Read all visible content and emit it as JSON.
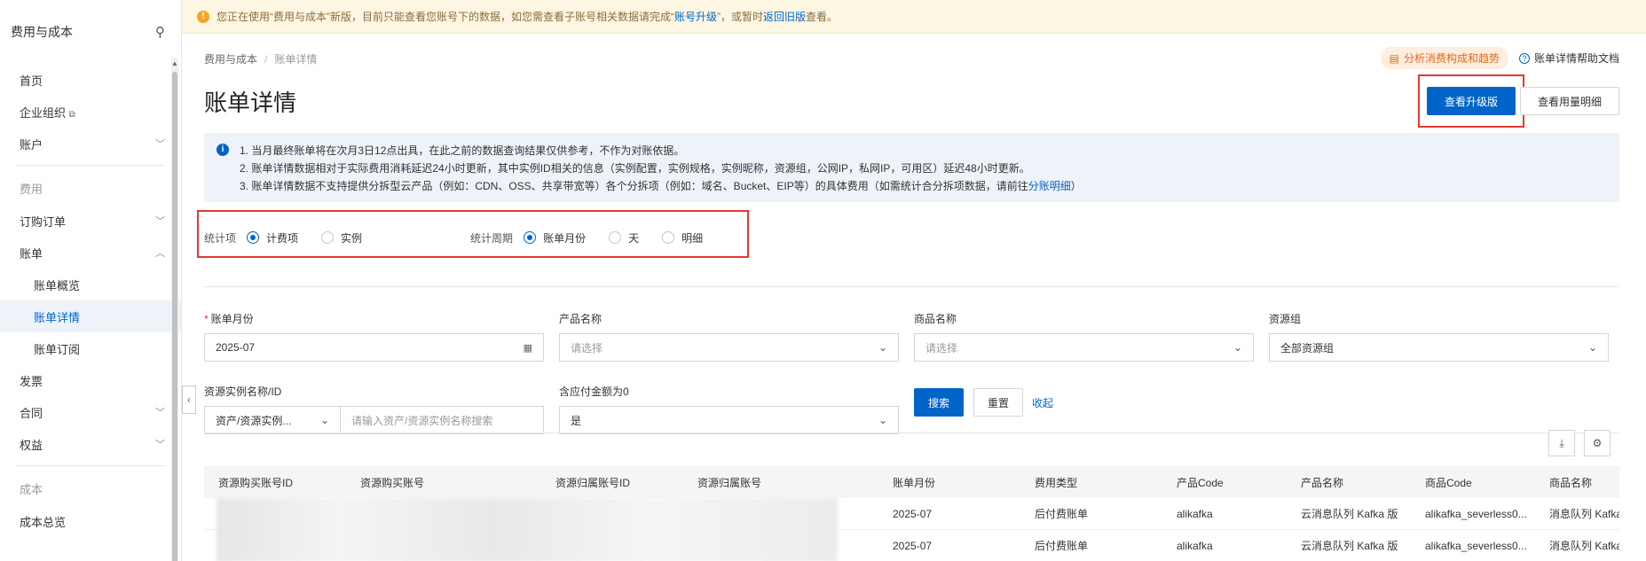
{
  "banner": {
    "text_before": "您正在使用“费用与成本”新版，目前只能查看您账号下的数据，如您需查看子账号相关数据请完成“",
    "link_upgrade": "账号升级",
    "text_middle": "”，或暂时",
    "link_old": "返回旧版",
    "text_after": "查看。"
  },
  "sidebar": {
    "title": "费用与成本",
    "items": [
      {
        "label": "首页"
      },
      {
        "label": "企业组织",
        "ext": "⧉"
      },
      {
        "label": "账户",
        "chev": "﹀"
      }
    ],
    "group_fee": "费用",
    "fee_items": [
      {
        "label": "订购订单",
        "chev": "﹀"
      },
      {
        "label": "账单",
        "chev": "︿"
      }
    ],
    "bill_sub": [
      "账单概览",
      "账单详情",
      "账单订阅"
    ],
    "fee_items2": [
      {
        "label": "发票"
      },
      {
        "label": "合同",
        "chev": "﹀"
      },
      {
        "label": "权益",
        "chev": "﹀"
      }
    ],
    "group_cost": "成本",
    "cost_items": [
      "成本总览"
    ]
  },
  "breadcrumb": {
    "root": "费用与成本",
    "sep": "/",
    "current": "账单详情"
  },
  "page": {
    "title": "账单详情",
    "analyze": "分析消费构成和趋势",
    "help": "账单详情帮助文档",
    "btn_upgrade": "查看升级版",
    "btn_usage": "查看用量明细"
  },
  "notice": {
    "line1": "1. 当月最终账单将在次月3日12点出具，在此之前的数据查询结果仅供参考，不作为对账依据。",
    "line2": "2. 账单详情数据相对于实际费用消耗延迟24小时更新，其中实例ID相关的信息（实例配置，实例规格，实例昵称，资源组，公网IP，私网IP，可用区）延迟48小时更新。",
    "line3_before": "3. 账单详情数据不支持提供分拆型云产品（例如：CDN、OSS、共享带宽等）各个分拆项（例如：域名、Bucket、EIP等）的具体费用（如需统计合分拆项数据，请前往",
    "line3_link": "分账明细",
    "line3_after": "）"
  },
  "stats": {
    "item_label": "统计项",
    "item_options": [
      "计费项",
      "实例"
    ],
    "period_label": "统计周期",
    "period_options": [
      "账单月份",
      "天",
      "明细"
    ]
  },
  "filters": {
    "bill_month_label": "账单月份",
    "bill_month_value": "2025-07",
    "product_label": "产品名称",
    "product_placeholder": "请选择",
    "commodity_label": "商品名称",
    "commodity_placeholder": "请选择",
    "rg_label": "资源组",
    "rg_value": "全部资源组",
    "instance_label": "资源实例名称/ID",
    "instance_type": "资产/资源实例...",
    "instance_placeholder": "请输入资产/资源实例名称搜索",
    "zero_label": "含应付金额为0",
    "zero_value": "是",
    "search": "搜索",
    "reset": "重置",
    "collapse": "收起"
  },
  "table": {
    "headers": [
      "资源购买账号ID",
      "资源购买账号",
      "资源归属账号ID",
      "资源归属账号",
      "账单月份",
      "费用类型",
      "产品Code",
      "产品名称",
      "商品Code",
      "商品名称"
    ],
    "rows": [
      [
        "",
        "",
        "",
        "",
        "2025-07",
        "后付费账单",
        "alikafka",
        "云消息队列 Kafka 版",
        "alikafka_severless0...",
        "消息队列 Kafka"
      ],
      [
        "",
        "",
        "",
        "",
        "2025-07",
        "后付费账单",
        "alikafka",
        "云消息队列 Kafka 版",
        "alikafka_severless0...",
        "消息队列 Kafka"
      ]
    ]
  },
  "colors": {
    "primary": "#0064c8",
    "highlight": "#e03a2e",
    "warn": "#f5a623"
  }
}
